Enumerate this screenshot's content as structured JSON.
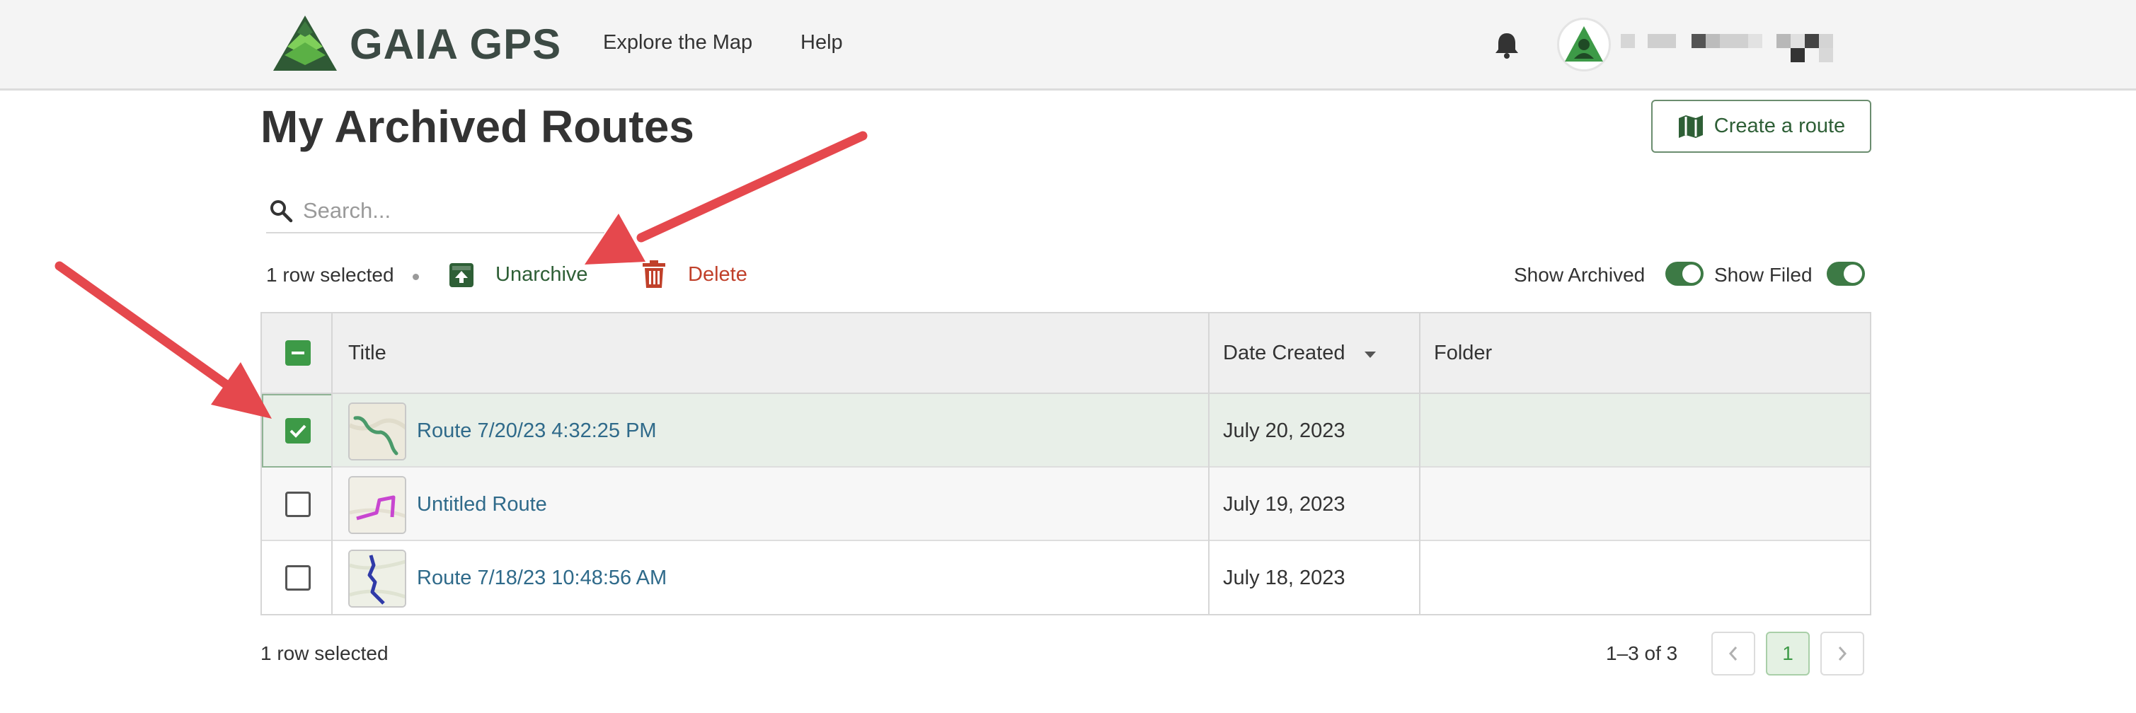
{
  "header": {
    "brand": "GAIA GPS",
    "nav": {
      "explore": "Explore the Map",
      "help": "Help"
    }
  },
  "page": {
    "title": "My Archived Routes",
    "create_button": "Create a route"
  },
  "search": {
    "placeholder": "Search...",
    "value": ""
  },
  "actions": {
    "selection_text": "1 row selected",
    "unarchive": "Unarchive",
    "delete": "Delete",
    "show_archived": {
      "label": "Show Archived",
      "on": true
    },
    "show_filed": {
      "label": "Show Filed",
      "on": true
    }
  },
  "table": {
    "columns": {
      "title": "Title",
      "date_created": "Date Created",
      "folder": "Folder"
    },
    "rows": [
      {
        "title": "Route 7/20/23 4:32:25 PM",
        "date": "July 20, 2023",
        "folder": "",
        "selected": true
      },
      {
        "title": "Untitled Route",
        "date": "July 19, 2023",
        "folder": "",
        "selected": false
      },
      {
        "title": "Route 7/18/23 10:48:56 AM",
        "date": "July 18, 2023",
        "folder": "",
        "selected": false
      }
    ]
  },
  "footer": {
    "selection_text": "1 row selected",
    "range": "1–3 of 3",
    "current_page": "1"
  },
  "icons": {
    "logo": "gaia-mountain-logo",
    "bell": "bell-icon",
    "search": "search-icon",
    "unarchive": "unarchive-box-icon",
    "delete": "trash-icon",
    "create": "map-icon"
  },
  "colors": {
    "brand_green": "#3d9a47",
    "action_green": "#2e5f36",
    "delete_red": "#c0402a",
    "link_blue": "#2f6a8a",
    "annotation_red": "#e5484d"
  }
}
